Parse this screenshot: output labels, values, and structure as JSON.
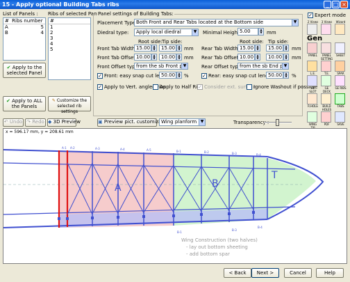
{
  "window": {
    "title": "15 - Apply optional Building Tabs ribs"
  },
  "left_panel": {
    "list_label": "List of Panels :",
    "panels_header": [
      "#",
      "Ribs number"
    ],
    "panels": [
      [
        "A",
        "5"
      ],
      [
        "B",
        "4"
      ]
    ],
    "ribs_label": "Ribs of selected Panel :",
    "ribs_header": "#",
    "ribs": [
      "1",
      "2",
      "3",
      "4",
      "5"
    ],
    "apply_selected": "Apply to the selected Panel",
    "apply_all": "Apply to ALL the Panels",
    "customize": "Customize the selected rib settings"
  },
  "settings": {
    "group_label": "Panel settings of Building Tabs:",
    "placement_label": "Placement Type:",
    "placement_value": "Both Front and Rear Tabs located at the Bottom side",
    "diedral_label": "Diedral type:",
    "diedral_value": "Apply local diedral",
    "min_height_label": "Minimal Height:",
    "min_height_value": "5.00",
    "min_height_unit": "mm",
    "root_side": "Root side:",
    "tip_side": "Tip side:",
    "front_width_label": "Front Tab Width:",
    "front_width_root": "15.00",
    "front_width_tip": "15.00",
    "front_offset_label": "Front Tab Offset:",
    "front_offset_root": "10.00",
    "front_offset_tip": "10.00",
    "front_offset_type_label": "Front Offset type:",
    "front_offset_type_value": "from the sb Front point",
    "front_snap_label": "Front: easy snap cut length:",
    "front_snap_value": "50.00",
    "rear_width_label": "Rear Tab Width:",
    "rear_width_root": "15.00",
    "rear_width_tip": "15.00",
    "rear_offset_label": "Rear Tab Offset:",
    "rear_offset_root": "10.00",
    "rear_offset_tip": "10.00",
    "rear_offset_type_label": "Rear Offset type:",
    "rear_offset_type_value": "from the sb End point",
    "rear_snap_label": "Rear: easy snap cut length:",
    "rear_snap_value": "50.00",
    "unit_mm": "mm",
    "unit_pct": "%",
    "chk_vert": "Apply to Vert. angled ribs",
    "chk_half": "Apply to Half Ribs",
    "chk_ext": "Consider ext. surface",
    "chk_washout": "Ignore Washout if possible"
  },
  "expert_mode": "Expert mode",
  "tools": {
    "row1": [
      "2 Views",
      "3 Views",
      "Wizard"
    ],
    "gen": "Gen",
    "row2": [
      "PANEL",
      "PANEL SETTING",
      "SHEET"
    ],
    "row3": [
      "L.E.",
      "T.E.",
      "SPAR"
    ],
    "row4": [
      "GE SLOT",
      "GE DECK",
      "GE RIBS"
    ],
    "row5": [
      "R.HOLE",
      "BUILD HOLES",
      "TABS"
    ],
    "row6": [
      "WING TIP",
      "PDF",
      "SAVE"
    ]
  },
  "toolbar2": {
    "undo": "Undo",
    "redo": "Redo",
    "preview3d": "3D Preview",
    "preview_custom": "Preview pict. customization",
    "view_value": "Wing planform",
    "transparency": "Transparency :"
  },
  "canvas": {
    "coords": "x = 596.17 mm, y = 208.61 mm",
    "label_a": "A",
    "label_b": "B",
    "label_t": "T",
    "note_title": "Wing Construction (two halves)",
    "note_1": "- lay out bottom sheeting",
    "note_2": "- add bottom spar"
  },
  "footer": {
    "back": "< Back",
    "next": "Next >",
    "cancel": "Cancel",
    "help": "Help"
  },
  "colors": {
    "panel_a": "#f4c6c6",
    "panel_b": "#c6f0c6",
    "spar": "#3f4fd0",
    "rib_root": "#e01010"
  }
}
